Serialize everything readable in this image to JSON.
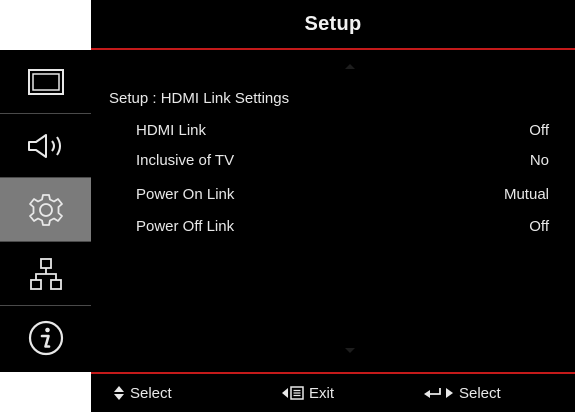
{
  "header": {
    "title": "Setup"
  },
  "sidebar": {
    "tabs": [
      {
        "icon": "display-icon",
        "active": false
      },
      {
        "icon": "audio-icon",
        "active": false
      },
      {
        "icon": "gear-icon",
        "active": true
      },
      {
        "icon": "network-icon",
        "active": false
      },
      {
        "icon": "info-icon",
        "active": false
      }
    ]
  },
  "menu": {
    "breadcrumb": "Setup : HDMI Link Settings",
    "items": [
      {
        "label": "HDMI Link",
        "value": "Off"
      },
      {
        "label": "Inclusive of TV",
        "value": "No"
      },
      {
        "label": "Power On Link",
        "value": "Mutual"
      },
      {
        "label": "Power Off Link",
        "value": "Off"
      }
    ]
  },
  "footer": {
    "hints": [
      {
        "icon": "up-down-arrows-icon",
        "label": "Select"
      },
      {
        "icon": "left-menu-icon",
        "label": "Exit"
      },
      {
        "icon": "enter-right-icon",
        "label": "Select"
      }
    ]
  },
  "colors": {
    "background": "#000000",
    "accent": "#c41a1a",
    "active_tab": "#7b7b7b",
    "text": "#e8e8e8"
  }
}
